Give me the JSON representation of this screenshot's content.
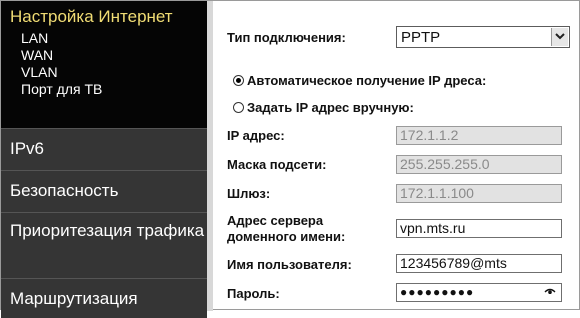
{
  "sidebar": {
    "title": "Настройка Интернет",
    "subitems": [
      "LAN",
      "WAN",
      "VLAN",
      "Порт для ТВ"
    ],
    "items": [
      "IPv6",
      "Безопасность",
      "Приоритезация трафика",
      "Маршрутизация"
    ]
  },
  "form": {
    "connection_type_label": "Тип подключения:",
    "connection_type_value": "PPTP",
    "radio_auto_label": "Автоматическое получение IP дреса:",
    "radio_manual_label": "Задать IP адрес вручную:",
    "ip_label": "IP адрес:",
    "ip_value": "172.1.1.2",
    "mask_label": "Маска подсети:",
    "mask_value": "255.255.255.0",
    "gateway_label": "Шлюз:",
    "gateway_value": "172.1.1.100",
    "server_label_line1": "Адрес сервера",
    "server_label_line2": "доменного имени:",
    "server_value": "vpn.mts.ru",
    "username_label": "Имя пользователя:",
    "username_value": "123456789@mts",
    "password_label": "Пароль:",
    "password_value": "●●●●●●●●●"
  },
  "colors": {
    "sidebar_bg": "#2b2b2b",
    "sidebar_head_bg": "#050505",
    "title_color": "#f0dc74",
    "disabled_field_bg": "#e2e2e2"
  },
  "icons": {
    "dropdown": "chevron-down-icon",
    "password_reveal": "eye-icon"
  }
}
